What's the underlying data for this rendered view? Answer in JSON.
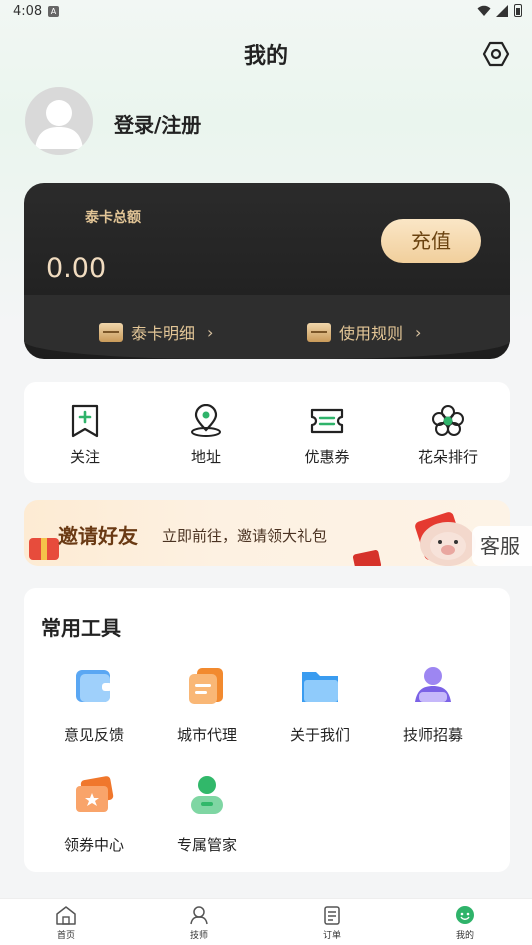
{
  "status_bar": {
    "time": "4:08"
  },
  "header": {
    "title": "我的"
  },
  "profile": {
    "login_label": "登录/注册"
  },
  "card": {
    "total_label": "泰卡总额",
    "amount": "0.00",
    "recharge_label": "充值",
    "detail_label": "泰卡明细",
    "rules_label": "使用规则"
  },
  "quick": [
    {
      "label": "关注",
      "icon": "bookmark-plus-icon"
    },
    {
      "label": "地址",
      "icon": "location-pin-icon"
    },
    {
      "label": "优惠券",
      "icon": "ticket-icon"
    },
    {
      "label": "花朵排行",
      "icon": "flower-icon"
    }
  ],
  "banner": {
    "title": "邀请好友",
    "subtitle": "立即前往，邀请领大礼包"
  },
  "customer_service": {
    "label": "客服"
  },
  "tools": {
    "title": "常用工具",
    "items": [
      {
        "label": "意见反馈",
        "icon": "feedback-wallet-icon"
      },
      {
        "label": "城市代理",
        "icon": "city-agent-icon"
      },
      {
        "label": "关于我们",
        "icon": "folder-icon"
      },
      {
        "label": "技师招募",
        "icon": "recruit-person-icon"
      },
      {
        "label": "领券中心",
        "icon": "coupon-center-icon"
      },
      {
        "label": "专属管家",
        "icon": "butler-icon"
      }
    ]
  },
  "tabbar": [
    {
      "label": "首页",
      "icon": "home-icon"
    },
    {
      "label": "技师",
      "icon": "technician-icon"
    },
    {
      "label": "订单",
      "icon": "order-icon"
    },
    {
      "label": "我的",
      "icon": "mine-icon",
      "active": true
    }
  ],
  "colors": {
    "accent_green": "#2fb36a",
    "gold_text": "#e2c596",
    "card_dark": "#222222"
  }
}
